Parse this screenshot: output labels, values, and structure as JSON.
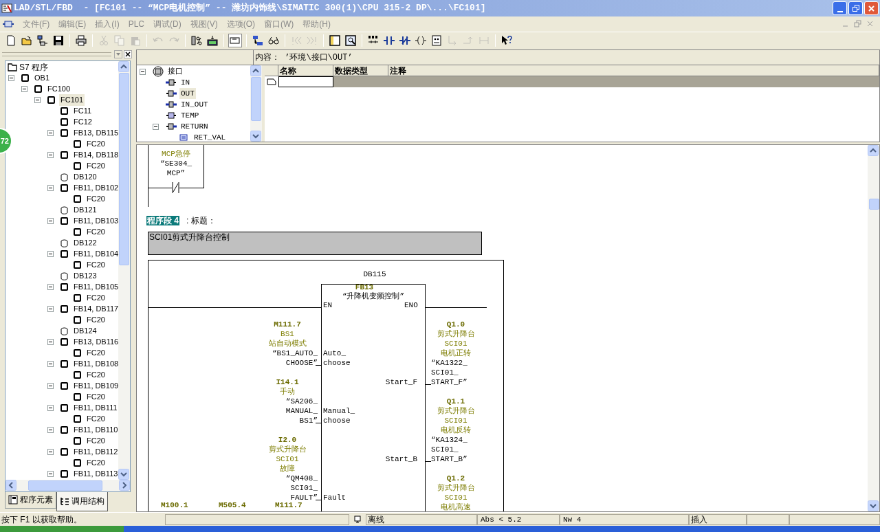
{
  "window": {
    "title": "LAD/STL/FBD  - [FC101 -- “MCP电机控制” -- 潍坊内饰线\\SIMATIC 300(1)\\CPU 315-2 DP\\...\\FC101]"
  },
  "menu": [
    "文件(F)",
    "编辑(E)",
    "插入(I)",
    "PLC",
    "调试(D)",
    "视图(V)",
    "选项(O)",
    "窗口(W)",
    "帮助(H)"
  ],
  "toolbar": [
    {
      "kind": "new",
      "disabled": false
    },
    {
      "kind": "open",
      "disabled": false
    },
    {
      "kind": "network",
      "disabled": false
    },
    {
      "kind": "save",
      "disabled": false
    },
    {
      "kind": "sep"
    },
    {
      "kind": "print",
      "disabled": false
    },
    {
      "kind": "sep"
    },
    {
      "kind": "cut",
      "disabled": true
    },
    {
      "kind": "copy",
      "disabled": true
    },
    {
      "kind": "paste",
      "disabled": true
    },
    {
      "kind": "sep"
    },
    {
      "kind": "undo",
      "disabled": true
    },
    {
      "kind": "redo",
      "disabled": true
    },
    {
      "kind": "sep"
    },
    {
      "kind": "compare",
      "disabled": false
    },
    {
      "kind": "download",
      "disabled": false
    },
    {
      "kind": "sep"
    },
    {
      "kind": "overview",
      "disabled": false,
      "on": true
    },
    {
      "kind": "sep"
    },
    {
      "kind": "netview",
      "disabled": false
    },
    {
      "kind": "glasses",
      "disabled": false
    },
    {
      "kind": "sep"
    },
    {
      "kind": "first",
      "disabled": true
    },
    {
      "kind": "last",
      "disabled": true
    },
    {
      "kind": "sep"
    },
    {
      "kind": "panel",
      "disabled": false
    },
    {
      "kind": "details",
      "disabled": false
    },
    {
      "kind": "sep"
    },
    {
      "kind": "element",
      "disabled": false
    },
    {
      "kind": "no-contact",
      "disabled": false
    },
    {
      "kind": "nc-contact",
      "disabled": false
    },
    {
      "kind": "coil",
      "disabled": false
    },
    {
      "kind": "box",
      "disabled": false
    },
    {
      "kind": "branch-open",
      "disabled": true
    },
    {
      "kind": "branch-close",
      "disabled": true
    },
    {
      "kind": "connect",
      "disabled": true
    },
    {
      "kind": "sep"
    },
    {
      "kind": "help",
      "disabled": false
    }
  ],
  "badge": "72",
  "tree": {
    "label": "S7 程序",
    "children": [
      {
        "label": "OB1",
        "kind": "block",
        "selected": false,
        "expanded": true,
        "children": [
          {
            "label": "FC100",
            "kind": "block",
            "selected": false,
            "expanded": true,
            "children": [
              {
                "label": "FC101",
                "kind": "block",
                "selected": true,
                "expanded": true,
                "children": [
                  {
                    "label": "FC11",
                    "kind": "block",
                    "selected": false
                  },
                  {
                    "label": "FC12",
                    "kind": "block",
                    "selected": false
                  },
                  {
                    "label": "FB13, DB115",
                    "kind": "block",
                    "selected": false,
                    "expanded": true,
                    "children": [
                      {
                        "label": "FC20",
                        "kind": "block",
                        "selected": false
                      }
                    ]
                  },
                  {
                    "label": "FB14, DB118",
                    "kind": "block",
                    "selected": false,
                    "expanded": true,
                    "children": [
                      {
                        "label": "FC20",
                        "kind": "block",
                        "selected": false
                      }
                    ]
                  },
                  {
                    "label": "DB120",
                    "kind": "db",
                    "selected": false
                  },
                  {
                    "label": "FB11, DB102",
                    "kind": "block",
                    "selected": false,
                    "expanded": true,
                    "children": [
                      {
                        "label": "FC20",
                        "kind": "block",
                        "selected": false
                      }
                    ]
                  },
                  {
                    "label": "DB121",
                    "kind": "db",
                    "selected": false
                  },
                  {
                    "label": "FB11, DB103",
                    "kind": "block",
                    "selected": false,
                    "expanded": true,
                    "children": [
                      {
                        "label": "FC20",
                        "kind": "block",
                        "selected": false
                      }
                    ]
                  },
                  {
                    "label": "DB122",
                    "kind": "db",
                    "selected": false
                  },
                  {
                    "label": "FB11, DB104",
                    "kind": "block",
                    "selected": false,
                    "expanded": true,
                    "children": [
                      {
                        "label": "FC20",
                        "kind": "block",
                        "selected": false
                      }
                    ]
                  },
                  {
                    "label": "DB123",
                    "kind": "db",
                    "selected": false
                  },
                  {
                    "label": "FB11, DB105",
                    "kind": "block",
                    "selected": false,
                    "expanded": true,
                    "children": [
                      {
                        "label": "FC20",
                        "kind": "block",
                        "selected": false
                      }
                    ]
                  },
                  {
                    "label": "FB14, DB117",
                    "kind": "block",
                    "selected": false,
                    "expanded": true,
                    "children": [
                      {
                        "label": "FC20",
                        "kind": "block",
                        "selected": false
                      }
                    ]
                  },
                  {
                    "label": "DB124",
                    "kind": "db",
                    "selected": false
                  },
                  {
                    "label": "FB13, DB116",
                    "kind": "block",
                    "selected": false,
                    "expanded": true,
                    "children": [
                      {
                        "label": "FC20",
                        "kind": "block",
                        "selected": false
                      }
                    ]
                  },
                  {
                    "label": "FB11, DB108",
                    "kind": "block",
                    "selected": false,
                    "expanded": true,
                    "children": [
                      {
                        "label": "FC20",
                        "kind": "block",
                        "selected": false
                      }
                    ]
                  },
                  {
                    "label": "FB11, DB109",
                    "kind": "block",
                    "selected": false,
                    "expanded": true,
                    "children": [
                      {
                        "label": "FC20",
                        "kind": "block",
                        "selected": false
                      }
                    ]
                  },
                  {
                    "label": "FB11, DB111",
                    "kind": "block",
                    "selected": false,
                    "expanded": true,
                    "children": [
                      {
                        "label": "FC20",
                        "kind": "block",
                        "selected": false
                      }
                    ]
                  },
                  {
                    "label": "FB11, DB110",
                    "kind": "block",
                    "selected": false,
                    "expanded": true,
                    "children": [
                      {
                        "label": "FC20",
                        "kind": "block",
                        "selected": false
                      }
                    ]
                  },
                  {
                    "label": "FB11, DB112",
                    "kind": "block",
                    "selected": false,
                    "expanded": true,
                    "children": [
                      {
                        "label": "FC20",
                        "kind": "block",
                        "selected": false
                      }
                    ]
                  },
                  {
                    "label": "FB11, DB113",
                    "kind": "block",
                    "selected": false,
                    "expanded": true
                  }
                ]
              }
            ]
          }
        ]
      }
    ]
  },
  "left_tabs": [
    {
      "label": "程序元素",
      "selected": false
    },
    {
      "label": "调用结构",
      "selected": true
    }
  ],
  "interface": {
    "content": "内容： ’环境\\接口\\OUT’",
    "tree": {
      "label": "接口",
      "kind": "interface",
      "selected": false,
      "expanded": true,
      "children": [
        {
          "label": "IN",
          "kind": "in",
          "selected": false
        },
        {
          "label": "OUT",
          "kind": "out",
          "selected": true
        },
        {
          "label": "IN_OUT",
          "kind": "inout",
          "selected": false
        },
        {
          "label": "TEMP",
          "kind": "temp",
          "selected": false
        },
        {
          "label": "RETURN",
          "kind": "out",
          "selected": false,
          "expanded": true,
          "children": [
            {
              "label": "RET_VAL",
              "kind": "retval",
              "selected": false
            }
          ]
        }
      ]
    },
    "columns": [
      "名称",
      "数据类型",
      "注释"
    ]
  },
  "ladder": {
    "previous": {
      "comment": [
        "MCP急停"
      ],
      "symbol": [
        "“SE304_",
        "MCP”"
      ]
    },
    "network": {
      "label": "程序段 4",
      "title": ": 标题：",
      "comment": "SCI01剪式升降台控制",
      "block": {
        "instance": "DB115",
        "name": "FB13",
        "symbol": "“升降机变频控制”",
        "en": "EN",
        "eno": "ENO",
        "inputs": [
          {
            "pin": [
              "Auto_",
              "choose"
            ],
            "address": "M111.7",
            "comment": [
              "BS1",
              "站自动模式"
            ],
            "symbol": [
              "“BS1_AUTO_",
              "CHOOSE”"
            ]
          },
          {
            "pin": [
              "Manual_",
              "choose"
            ],
            "address": "I14.1",
            "comment": [
              "手动"
            ],
            "symbol": [
              "“SA206_",
              "MANUAL_",
              "BS1”"
            ]
          },
          {
            "pin": [
              "Fault"
            ],
            "address": "I2.0",
            "comment": [
              "剪式升降台",
              "SCI01",
              "故障"
            ],
            "symbol": [
              "“QM408_",
              "SCI01_",
              "FAULT”"
            ]
          }
        ],
        "outputs": [
          {
            "pin": "Start_F",
            "address": "Q1.0",
            "comment": [
              "剪式升降台",
              "SCI01",
              "电机正转"
            ],
            "symbol": [
              "“KA1322_",
              "SCI01_",
              "START_F”"
            ]
          },
          {
            "pin": "Start_B",
            "address": "Q1.1",
            "comment": [
              "剪式升降台",
              "SCI01",
              "电机反转"
            ],
            "symbol": [
              "“KA1324_",
              "SCI01_",
              "START_B”"
            ]
          },
          {
            "address": "Q1.2",
            "comment": [
              "剪式升降台",
              "SCI01",
              "电机高速"
            ]
          }
        ]
      },
      "bottom_addresses": [
        "M100.1",
        "M505.4",
        "M111.7"
      ]
    }
  },
  "status_bar": {
    "help": "按下 F1 以获取帮助。",
    "mode": "离线",
    "position": "Abs < 5.2",
    "network": "Nw 4",
    "insert": "插入"
  }
}
